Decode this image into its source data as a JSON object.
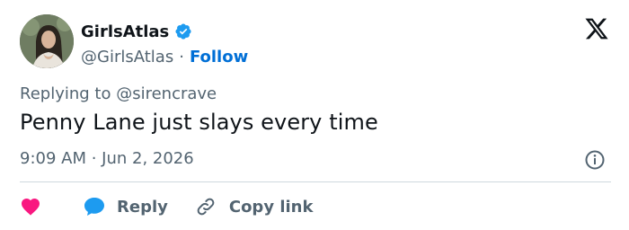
{
  "header": {
    "display_name": "GirlsAtlas",
    "handle": "@GirlsAtlas",
    "separator": "·",
    "follow_label": "Follow"
  },
  "tweet": {
    "reply_context": "Replying to @sirencrave",
    "text": "Penny Lane just slays every time",
    "timestamp": "9:09 AM · Jun 2, 2026"
  },
  "actions": {
    "reply_label": "Reply",
    "copy_link_label": "Copy link"
  },
  "icons": {
    "verified": "verified-badge-icon",
    "platform": "x-logo-icon",
    "info": "info-icon",
    "like": "heart-icon",
    "reply": "speech-bubble-icon",
    "copy": "link-icon"
  },
  "colors": {
    "text": "#0f1419",
    "secondary": "#536471",
    "link_blue": "#006fd6",
    "verified_blue": "#1d9bf0",
    "heart_pink": "#f91880",
    "divider": "#cfd9de"
  }
}
